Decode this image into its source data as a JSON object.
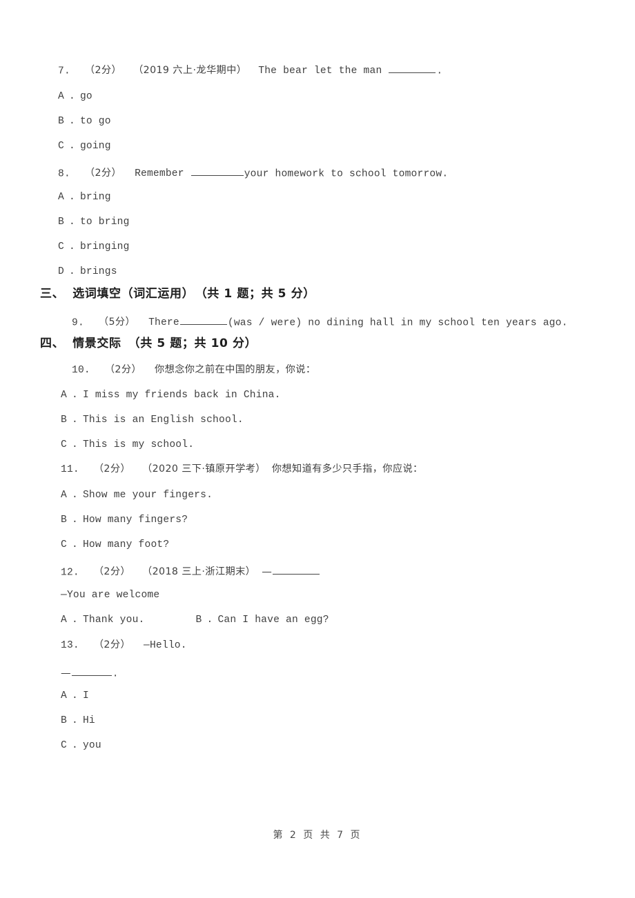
{
  "document": {
    "page_footer": "第 2 页 共 7 页"
  },
  "questions": [
    {
      "number": "7.",
      "points": "（2分）",
      "source": "（2019 六上·龙华期中）",
      "stem_text": "The bear let the man",
      "stem_tail": ".",
      "options": [
        {
          "label": "A",
          "text": "go"
        },
        {
          "label": "B",
          "text": "to go"
        },
        {
          "label": "C",
          "text": "going"
        }
      ]
    },
    {
      "number": "8.",
      "points": "（2分）",
      "source": "",
      "stem_text": "Remember",
      "stem_tail": "your homework to school tomorrow.",
      "options": [
        {
          "label": "A",
          "text": "bring"
        },
        {
          "label": "B",
          "text": "to bring"
        },
        {
          "label": "C",
          "text": "bringing"
        },
        {
          "label": "D",
          "text": "brings"
        }
      ]
    },
    {
      "number": "9.",
      "points": "（5分）",
      "stem_text": "There",
      "stem_tail": "(was / were) no dining hall in my school ten years ago."
    },
    {
      "number": "10.",
      "points": "（2分）",
      "source": "",
      "stem_text": "你想念你之前在中国的朋友，你说：",
      "options": [
        {
          "label": "A",
          "text": "I miss my friends back in China."
        },
        {
          "label": "B",
          "text": "This is an English school."
        },
        {
          "label": "C",
          "text": "This is my school."
        }
      ]
    },
    {
      "number": "11.",
      "points": "（2分）",
      "source": "（2020 三下·镇原开学考）",
      "stem_text": "你想知道有多少只手指，你应说：",
      "options": [
        {
          "label": "A",
          "text": "Show me your fingers."
        },
        {
          "label": "B",
          "text": "How many fingers?"
        },
        {
          "label": "C",
          "text": "How many foot?"
        }
      ]
    },
    {
      "number": "12.",
      "points": "（2分）",
      "source": "（2018 三上·浙江期末）",
      "stem_dash": "—",
      "reply_line": "—You are welcome",
      "options": [
        {
          "label": "A",
          "text": "Thank you."
        },
        {
          "label": "B",
          "text": "Can I have an egg?"
        }
      ]
    },
    {
      "number": "13.",
      "points": "（2分）",
      "stem_text": "—Hello.",
      "reply_dash": "—",
      "reply_tail": ".",
      "options": [
        {
          "label": "A",
          "text": "I"
        },
        {
          "label": "B",
          "text": "Hi"
        },
        {
          "label": "C",
          "text": "you"
        }
      ]
    }
  ],
  "sections": [
    {
      "number": "三、",
      "title": "选词填空（词汇运用）",
      "meta": "（共 1 题；共 5 分）"
    },
    {
      "number": "四、",
      "title": "情景交际",
      "meta": "（共 5 题；共 10 分）"
    }
  ]
}
